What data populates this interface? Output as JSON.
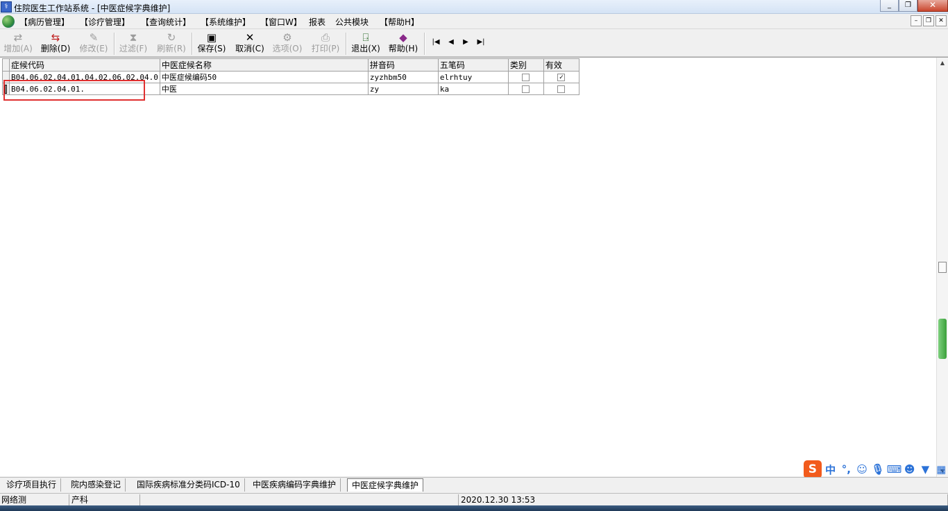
{
  "window": {
    "title": "住院医生工作站系统 - [中医症候字典维护]",
    "buttons": [
      "_",
      "❐",
      "✕"
    ]
  },
  "menubar": {
    "items": [
      "【病历管理】",
      "【诊疗管理】",
      "【查询统计】",
      "【系统维护】",
      "【窗口W】",
      "报表",
      "公共模块",
      "【帮助H】"
    ],
    "mdi_buttons": [
      "–",
      "❐",
      "✕"
    ]
  },
  "toolbar": {
    "add": "增加(A)",
    "delete": "删除(D)",
    "edit": "修改(E)",
    "filter": "过滤(F)",
    "refresh": "刷新(R)",
    "save": "保存(S)",
    "cancel": "取消(C)",
    "options": "选项(O)",
    "print": "打印(P)",
    "exit": "退出(X)",
    "help": "帮助(H)",
    "nav": [
      "|◀",
      "◀",
      "▶",
      "▶|"
    ]
  },
  "grid": {
    "columns": [
      "症候代码",
      "中医症候名称",
      "拼音码",
      "五笔码",
      "类别",
      "有效"
    ],
    "rows": [
      {
        "code": "B04.06.02.04.01.04.02.06.02.04.0",
        "name": "中医症候编码50",
        "pinyin": "zyzhbm50",
        "wubi": "elrhtuy",
        "category": false,
        "valid": true
      },
      {
        "code": "B04.06.02.04.01.",
        "name": "中医",
        "pinyin": "zy",
        "wubi": "ka",
        "category": false,
        "valid": false
      }
    ],
    "check_mark": "✓"
  },
  "ime": {
    "logo": "S",
    "lang": "中",
    "punct": "°,",
    "icons": [
      "smile-icon",
      "mic-icon",
      "keyboard-icon",
      "person-icon",
      "shirt-icon",
      "grid-icon"
    ]
  },
  "tabs": [
    "诊疗项目执行",
    "院内感染登记",
    "国际疾病标准分类码ICD-10",
    "中医疾病编码字典维护",
    "中医症候字典维护"
  ],
  "status": {
    "network": "网络测",
    "department": "产科",
    "middle": "",
    "datetime": "2020.12.30 13:53"
  }
}
